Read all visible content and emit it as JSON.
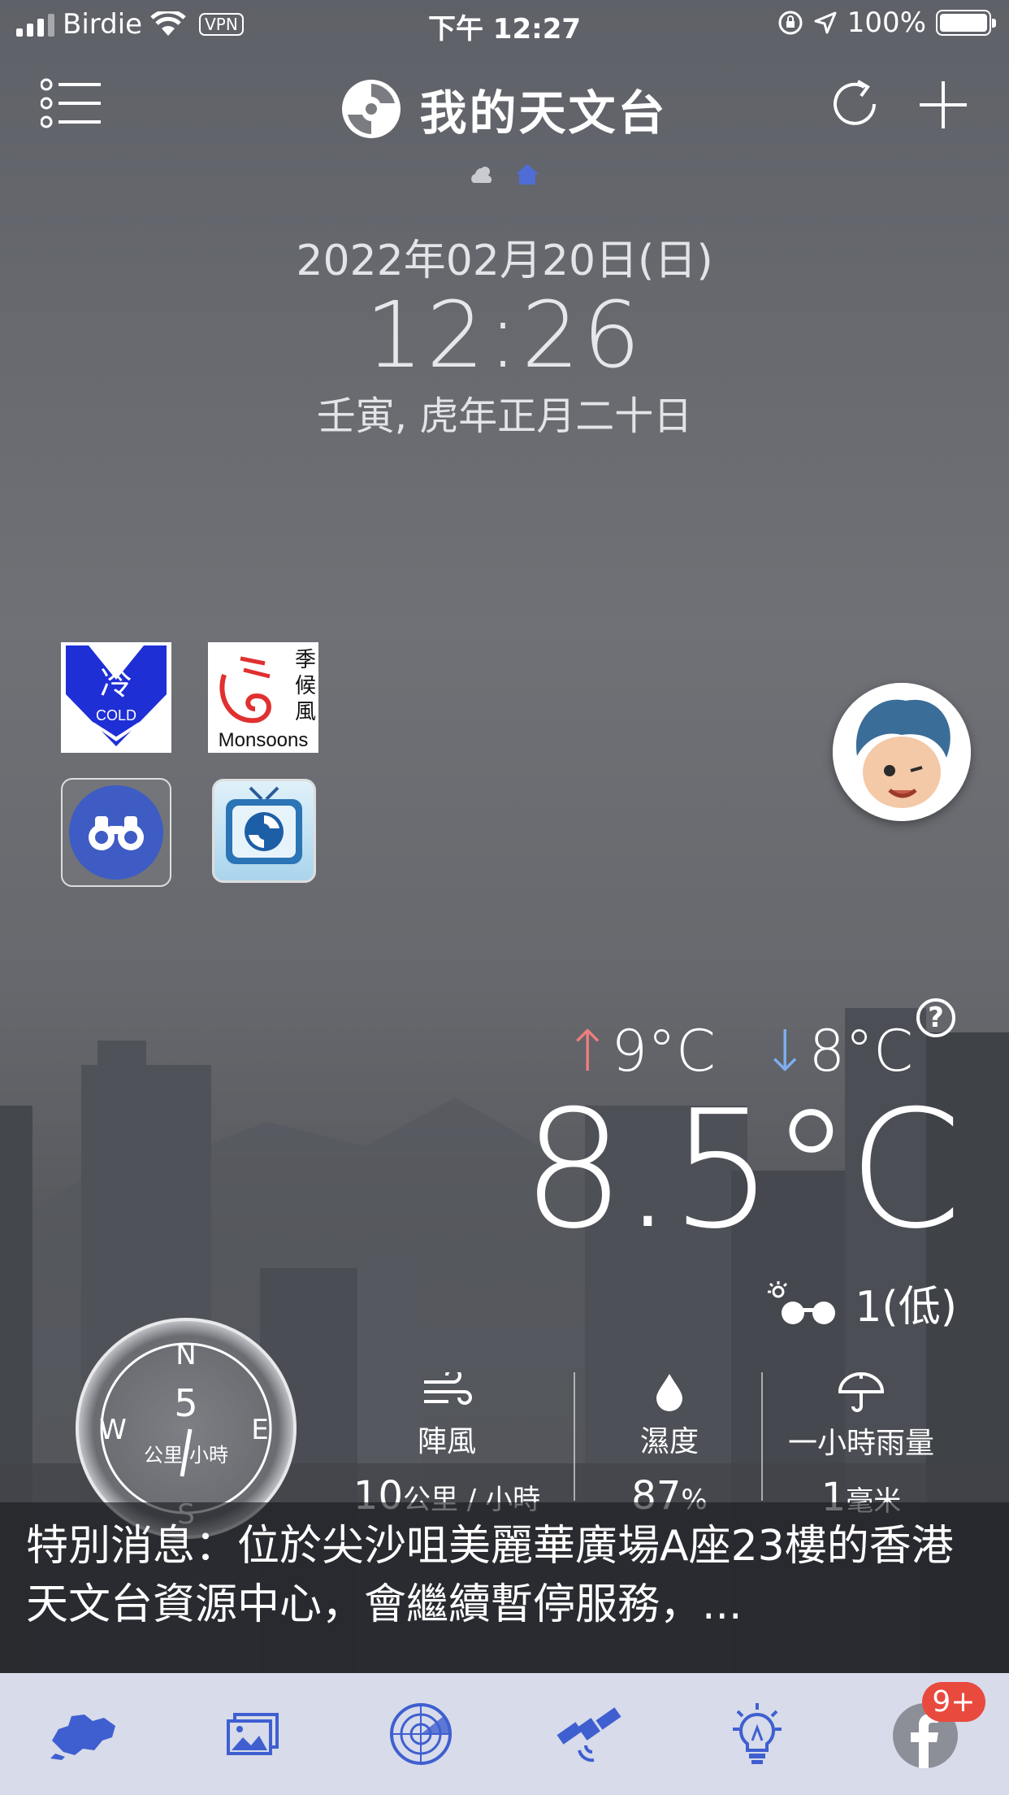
{
  "status_bar": {
    "carrier": "Birdie",
    "vpn": "VPN",
    "time": "下午 12:27",
    "battery": "100%"
  },
  "header": {
    "title": "我的天文台"
  },
  "datetime": {
    "date": "2022年02月20日(日)",
    "time": "12:26",
    "lunar": "壬寅, 虎年正月二十日"
  },
  "warnings": {
    "cold": {
      "char": "冷",
      "label": "COLD"
    },
    "monsoon": {
      "chars": "季候風",
      "label": "Monsoons"
    }
  },
  "temperature": {
    "max": "9°C",
    "min": "8°C",
    "current": "8.5°C",
    "uv": "1(低)",
    "help": "?"
  },
  "wind": {
    "dir_n": "N",
    "dir_e": "E",
    "dir_s": "S",
    "dir_w": "W",
    "speed": "5",
    "unit": "公里/小時"
  },
  "stats": {
    "gust": {
      "label": "陣風",
      "value": "10",
      "unit": "公里 / 小時"
    },
    "humidity": {
      "label": "濕度",
      "value": "87",
      "unit": "%"
    },
    "rainfall": {
      "label": "一小時雨量",
      "value": "1",
      "unit": "毫米"
    }
  },
  "message": {
    "text": "特別消息：位於尖沙咀美麗華廣場A座23樓的香港天文台資源中心，會繼續暫停服務，..."
  },
  "tabbar": {
    "badge": "9+"
  },
  "colors": {
    "accent": "#3f5fd0",
    "tabbar_bg": "#d7dbea",
    "badge": "#e84a3e"
  }
}
